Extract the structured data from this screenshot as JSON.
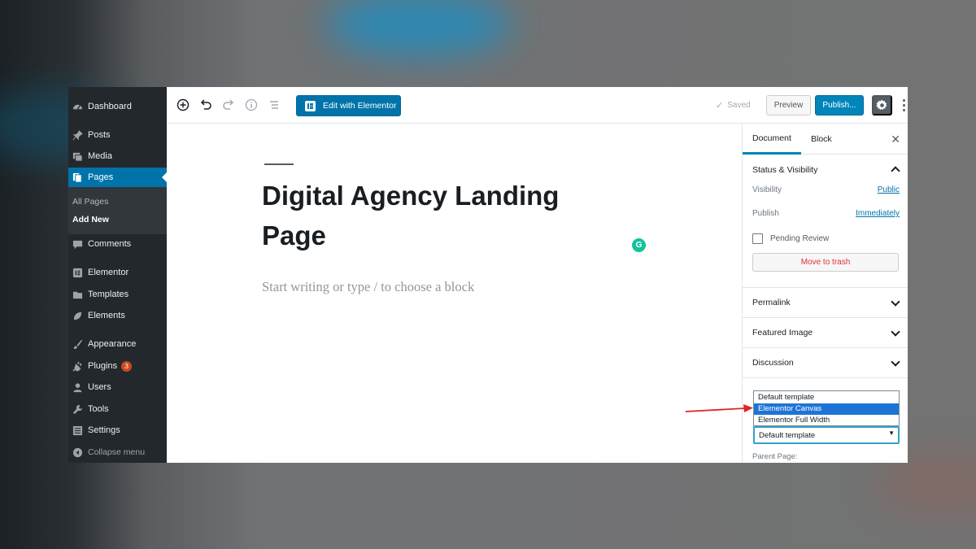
{
  "admin_menu": {
    "dashboard": "Dashboard",
    "posts": "Posts",
    "media": "Media",
    "pages": "Pages",
    "pages_sub": [
      "All Pages",
      "Add New"
    ],
    "comments": "Comments",
    "elementor": "Elementor",
    "templates": "Templates",
    "elements": "Elements",
    "appearance": "Appearance",
    "plugins": "Plugins",
    "plugins_badge": "3",
    "users": "Users",
    "tools": "Tools",
    "settings": "Settings",
    "collapse": "Collapse menu"
  },
  "toolbar": {
    "edit_with_elementor": "Edit with Elementor",
    "saved": "Saved",
    "preview": "Preview",
    "publish": "Publish..."
  },
  "editor": {
    "title": "Digital Agency Landing Page",
    "placeholder": "Start writing or type / to choose a block"
  },
  "sidebar": {
    "tabs": [
      "Document",
      "Block"
    ],
    "status_visibility": {
      "heading": "Status & Visibility",
      "visibility_label": "Visibility",
      "visibility_value": "Public",
      "publish_label": "Publish",
      "publish_value": "Immediately",
      "pending_review": "Pending Review",
      "pending_review_checked": false,
      "move_to_trash": "Move to trash"
    },
    "permalink": "Permalink",
    "featured_image": "Featured Image",
    "discussion": "Discussion",
    "template_options": [
      "Default template",
      "Elementor Canvas",
      "Elementor Full Width"
    ],
    "template_highlighted": "Elementor Canvas",
    "template_selected": "Default template",
    "parent_page_label": "Parent Page:"
  },
  "colors": {
    "admin_bg": "#23282d",
    "admin_active": "#0073aa",
    "primary_button": "#0085ba",
    "trash_text": "#dc3232",
    "annotation_arrow": "#e02424"
  }
}
